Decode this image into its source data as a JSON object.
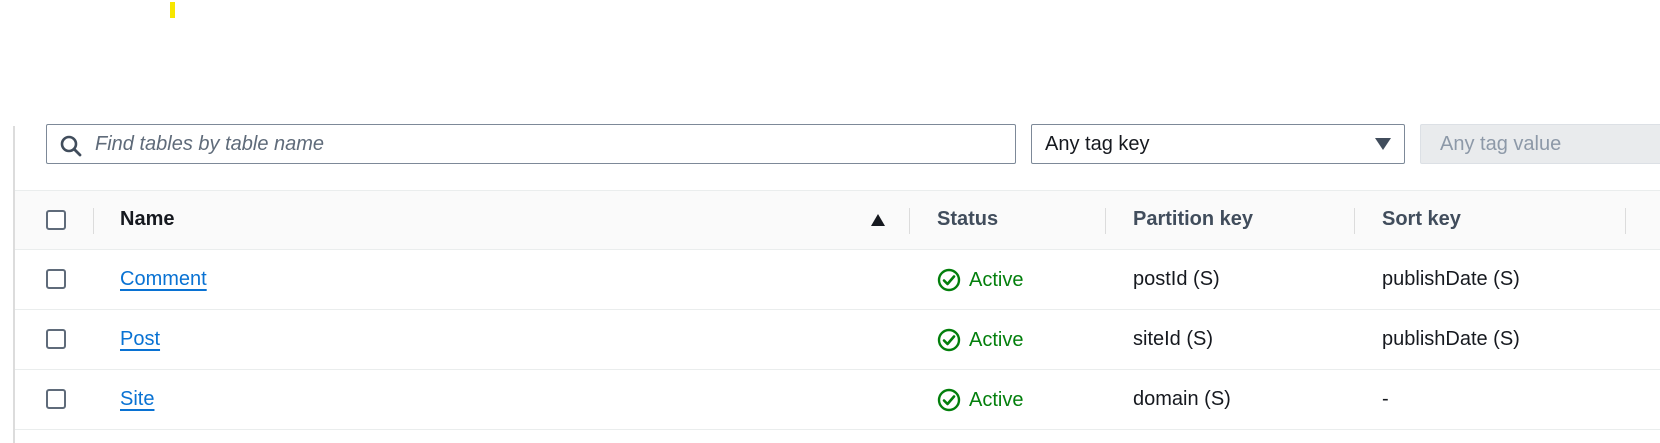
{
  "filters": {
    "search_placeholder": "Find tables by table name",
    "tag_key_label": "Any tag key",
    "tag_value_placeholder": "Any tag value"
  },
  "table": {
    "columns": {
      "name": "Name",
      "status": "Status",
      "partition_key": "Partition key",
      "sort_key": "Sort key"
    },
    "sort": {
      "column": "Name",
      "direction": "ascending",
      "icon": "triangle-up-icon"
    },
    "rows": [
      {
        "name": "Comment",
        "status": "Active",
        "partition_key": "postId (S)",
        "sort_key": "publishDate (S)"
      },
      {
        "name": "Post",
        "status": "Active",
        "partition_key": "siteId (S)",
        "sort_key": "publishDate (S)"
      },
      {
        "name": "Site",
        "status": "Active",
        "partition_key": "domain (S)",
        "sort_key": "-"
      }
    ]
  },
  "colors": {
    "link": "#0972d3",
    "status_active": "#037f0c",
    "cursor_highlight": "#f7e600"
  },
  "icons": {
    "search": "search-icon",
    "dropdown": "caret-down-icon",
    "status_active": "check-circle-icon"
  }
}
